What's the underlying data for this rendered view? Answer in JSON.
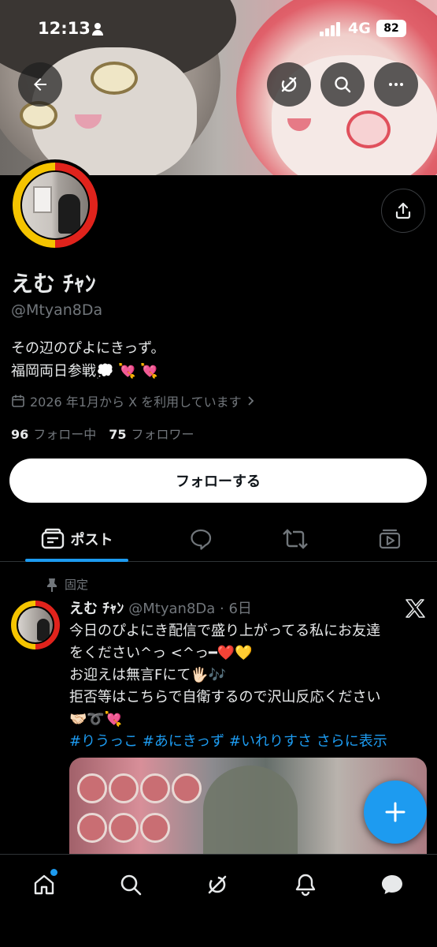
{
  "status_bar": {
    "time": "12:13",
    "network": "4G",
    "battery": "82"
  },
  "profile": {
    "display_name": "えむ ﾁｬﾝ",
    "handle": "@Mtyan8Da",
    "bio_lines": [
      "その辺のぴよにきっず。",
      "福岡両日参戦💭 💘 💘"
    ],
    "joined": "2026 年1月から X を利用しています",
    "following_count": "96",
    "following_label": "フォロー中",
    "followers_count": "75",
    "followers_label": "フォロワー",
    "follow_button": "フォローする"
  },
  "tabs": {
    "posts_label": "ポスト"
  },
  "post": {
    "pinned_label": "固定",
    "author_name": "えむ ﾁｬﾝ",
    "author_meta": "@Mtyan8Da · 6日",
    "lines": [
      "今日のぴよにき配信で盛り上がってる私にお友達",
      "をください^っ <^っ━❤️💛",
      "お迎えは無言Fにて🖐🏻🎶",
      "拒否等はこちらで自衛するので沢山反応ください",
      "🤝🏻➰💘"
    ],
    "hashtags": "#りうっこ #あにきっず #いれりすさ さらに表示"
  },
  "colors": {
    "accent": "#1d9bf0",
    "muted": "#71767b",
    "text": "#e7e9ea",
    "background": "#000000"
  }
}
